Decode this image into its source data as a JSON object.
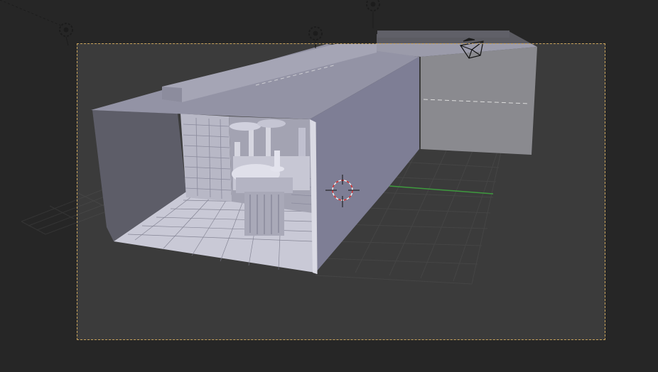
{
  "viewport": {
    "mode": "camera-view",
    "shading": "solid",
    "colors": {
      "background": "#272727",
      "passepartout": "#3a3a3a",
      "camera_border": "#c9a45c",
      "grid": "#3f3f3f",
      "x_axis": "#44a244",
      "model_light": "#b9b9c8",
      "model_mid": "#8f8fa6",
      "model_dark": "#6b6b80"
    },
    "icons": {
      "lamps": [
        "lamp-icon",
        "lamp-icon",
        "lamp-icon"
      ],
      "camera": "camera-icon",
      "cursor": "3d-cursor-icon"
    }
  }
}
